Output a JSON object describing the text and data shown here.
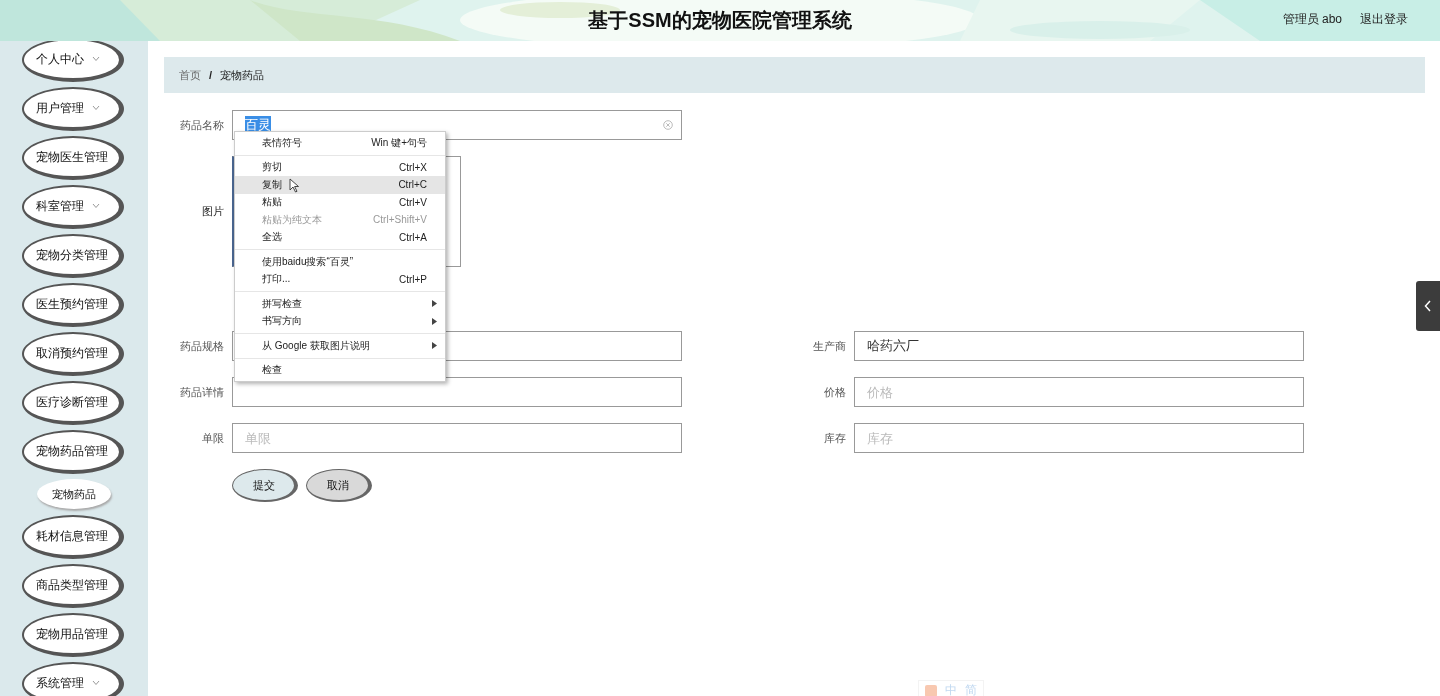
{
  "header": {
    "title": "基于SSM的宠物医院管理系统",
    "user": "管理员 abo",
    "logout": "退出登录"
  },
  "sidebar": {
    "items": [
      {
        "label": "个人中心",
        "chevron": true
      },
      {
        "label": "用户管理",
        "chevron": true
      },
      {
        "label": "宠物医生管理",
        "chevron": false
      },
      {
        "label": "科室管理",
        "chevron": true
      },
      {
        "label": "宠物分类管理",
        "chevron": false
      },
      {
        "label": "医生预约管理",
        "chevron": false
      },
      {
        "label": "取消预约管理",
        "chevron": false
      },
      {
        "label": "医疗诊断管理",
        "chevron": false
      },
      {
        "label": "宠物药品管理",
        "chevron": false,
        "children": [
          {
            "label": "宠物药品"
          }
        ]
      },
      {
        "label": "耗材信息管理",
        "chevron": false
      },
      {
        "label": "商品类型管理",
        "chevron": false
      },
      {
        "label": "宠物用品管理",
        "chevron": false
      },
      {
        "label": "系统管理",
        "chevron": true
      }
    ]
  },
  "breadcrumb": [
    "首页",
    "宠物药品"
  ],
  "breadcrumb_separator": "/",
  "form": {
    "name": {
      "label": "药品名称",
      "value": "百灵"
    },
    "image": {
      "label": "图片"
    },
    "rows": [
      [
        {
          "label": "药品规格"
        },
        {
          "label": "生产商",
          "value": "哈药六厂"
        }
      ],
      [
        {
          "label": "药品详情"
        },
        {
          "label": "价格",
          "placeholder": "价格"
        }
      ],
      [
        {
          "label": "单限",
          "placeholder": "单限"
        },
        {
          "label": "库存",
          "placeholder": "库存"
        }
      ]
    ],
    "buttons": [
      {
        "label": "提交",
        "kind": "primary"
      },
      {
        "label": "取消",
        "kind": "secondary"
      }
    ]
  },
  "context_menu": {
    "groups": [
      [
        {
          "label": "表情符号",
          "shortcut": "Win 键+句号",
          "selected": false,
          "disabled": false,
          "submenu": false
        }
      ],
      [
        {
          "label": "剪切",
          "shortcut": "Ctrl+X",
          "selected": false,
          "disabled": false,
          "submenu": false
        },
        {
          "label": "复制",
          "shortcut": "Ctrl+C",
          "selected": true,
          "disabled": false,
          "submenu": false
        },
        {
          "label": "粘贴",
          "shortcut": "Ctrl+V",
          "selected": false,
          "disabled": false,
          "submenu": false
        },
        {
          "label": "粘贴为纯文本",
          "shortcut": "Ctrl+Shift+V",
          "selected": false,
          "disabled": true,
          "submenu": false
        },
        {
          "label": "全选",
          "shortcut": "Ctrl+A",
          "selected": false,
          "disabled": false,
          "submenu": false
        }
      ],
      [
        {
          "label": "使用baidu搜索“百灵”",
          "selected": false,
          "disabled": false,
          "submenu": false
        },
        {
          "label": "打印...",
          "shortcut": "Ctrl+P",
          "selected": false,
          "disabled": false,
          "submenu": false
        }
      ],
      [
        {
          "label": "拼写检查",
          "selected": false,
          "disabled": false,
          "submenu": true
        },
        {
          "label": "书写方向",
          "selected": false,
          "disabled": false,
          "submenu": true
        }
      ],
      [
        {
          "label": "从 Google 获取图片说明",
          "selected": false,
          "disabled": false,
          "submenu": true
        }
      ],
      [
        {
          "label": "检查",
          "selected": false,
          "disabled": false,
          "submenu": false
        }
      ]
    ]
  },
  "ime_toolbar": {
    "items": [
      "中",
      "简"
    ]
  }
}
